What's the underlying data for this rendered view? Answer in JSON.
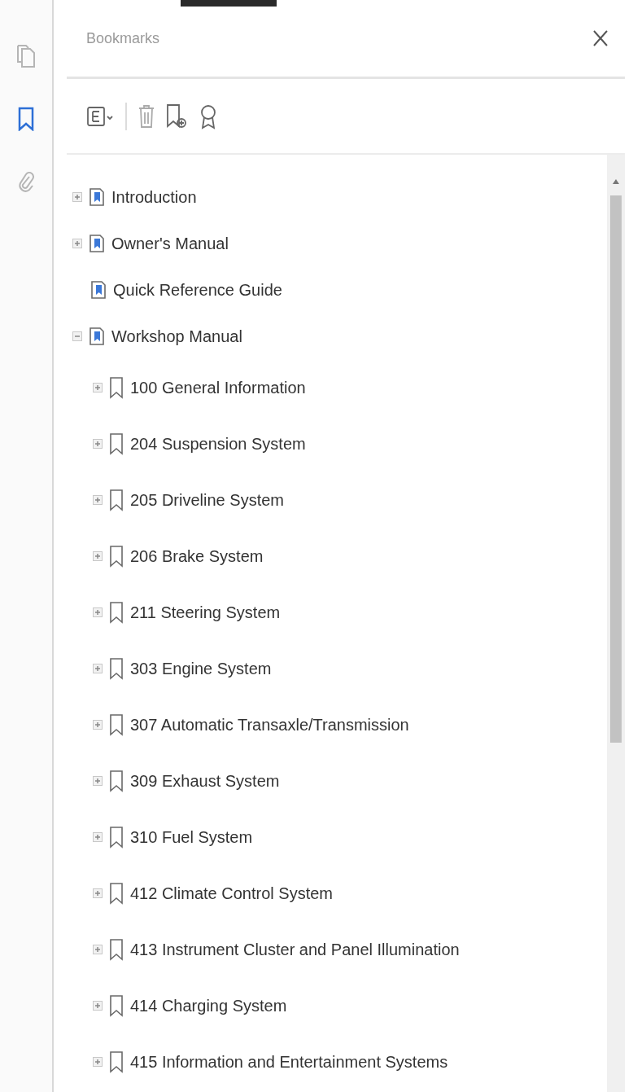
{
  "sidebar": {
    "tools": [
      {
        "kind": "pages",
        "selected": false
      },
      {
        "kind": "bookmarks",
        "selected": true
      },
      {
        "kind": "attachments",
        "selected": false
      }
    ]
  },
  "panel": {
    "title": "Bookmarks"
  },
  "tree": [
    {
      "label": "Introduction",
      "kind": "document",
      "expanded": false
    },
    {
      "label": "Owner's Manual",
      "kind": "document",
      "expanded": false
    },
    {
      "label": "Quick Reference Guide",
      "kind": "document"
    },
    {
      "label": "Workshop Manual",
      "kind": "document",
      "expanded": true,
      "children": [
        {
          "label": "100 General Information",
          "kind": "bookmark",
          "expanded": false
        },
        {
          "label": "204 Suspension System",
          "kind": "bookmark",
          "expanded": false
        },
        {
          "label": "205 Driveline System",
          "kind": "bookmark",
          "expanded": false
        },
        {
          "label": "206 Brake System",
          "kind": "bookmark",
          "expanded": false
        },
        {
          "label": "211 Steering System",
          "kind": "bookmark",
          "expanded": false
        },
        {
          "label": "303 Engine System",
          "kind": "bookmark",
          "expanded": false
        },
        {
          "label": "307 Automatic Transaxle/Transmission",
          "kind": "bookmark",
          "expanded": false
        },
        {
          "label": "309 Exhaust System",
          "kind": "bookmark",
          "expanded": false
        },
        {
          "label": "310 Fuel System",
          "kind": "bookmark",
          "expanded": false
        },
        {
          "label": "412 Climate Control System",
          "kind": "bookmark",
          "expanded": false
        },
        {
          "label": "413 Instrument Cluster and Panel Illumination",
          "kind": "bookmark",
          "expanded": false
        },
        {
          "label": "414 Charging System",
          "kind": "bookmark",
          "expanded": false
        },
        {
          "label": "415 Information and Entertainment Systems",
          "kind": "bookmark",
          "expanded": false
        }
      ]
    }
  ]
}
